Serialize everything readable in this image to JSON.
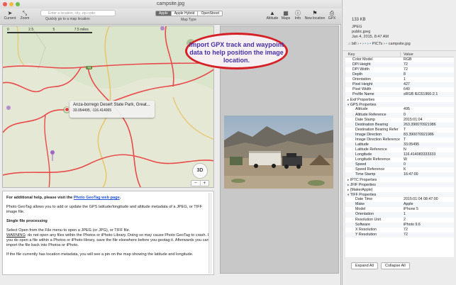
{
  "window": {
    "title": "campsite.jpg"
  },
  "toolbar": {
    "current_label": "Current",
    "zoom_label": "Zoom",
    "search_placeholder": "Enter a location, city, zip code",
    "quick_label": "Quickly go to a map location",
    "map_types": [
      "Apple",
      "Apple Hybrid",
      "OpenStreet"
    ],
    "map_type_selected": "Apple",
    "map_type_label": "Map Type",
    "right_buttons": [
      "Altitude",
      "Maps",
      "Info",
      "New location",
      "GPX"
    ]
  },
  "map": {
    "scale_labels": [
      "0",
      "2.5",
      "5",
      "7.5 miles"
    ],
    "route_number": "78",
    "pin_title": "Anza-borrego Desert State Park, Great...",
    "pin_coords": "33.054495, -116.414065",
    "btn_3d": "3D",
    "zoom_out": "−",
    "zoom_in": "+"
  },
  "callout": {
    "text": "Import GPX track and waypoint data to help position the image location."
  },
  "help": {
    "intro_prefix": "For additional help, please visit the ",
    "intro_link": "Photo GeoTag web page",
    "intro_suffix": ".",
    "p1": "Photo GeoTag allows you to add or update the GPS latitude/longitude and altitude metadata of a JPEG, or TIFF image file.",
    "heading": "Single file processing",
    "p2a": "Select Open from the File menu to open a JPEG (or JPG), or TIFF file.",
    "p2b_warning": "WARNING",
    "p2b": ": do not open any files within the Photos or iPhoto Library.  Doing so may cause Photo GeoTag to crash.  If you do open a file within a Photos or iPhoto library, save the file elsewhere before you geotag it.  Afterwards you can import the file back into Photos or iPhoto.",
    "p3": "If the file currently has location metadata, you will see a pin on the map showing the latitude and longitude."
  },
  "inspector": {
    "file_size": "133 KB",
    "format": "JPEG",
    "public": "public.jpeg",
    "date": "Jan 4, 2015, 8:47 AM",
    "path": [
      "bill",
      "",
      "",
      "PICTs",
      "",
      "campsite.jpg"
    ],
    "col_key": "Key",
    "col_value": "Value",
    "rows": [
      {
        "k": "Color Model",
        "v": "RGB",
        "i": 1
      },
      {
        "k": "DPI Height",
        "v": "72",
        "i": 1
      },
      {
        "k": "DPI Width",
        "v": "72",
        "i": 1
      },
      {
        "k": "Depth",
        "v": "8",
        "i": 1
      },
      {
        "k": "Orientation",
        "v": "1",
        "i": 1
      },
      {
        "k": "Pixel Height",
        "v": "427",
        "i": 1
      },
      {
        "k": "Pixel Width",
        "v": "640",
        "i": 1
      },
      {
        "k": "Profile Name",
        "v": "sRGB IEC61966-2.1",
        "i": 1
      },
      {
        "k": "Exif Properties",
        "v": "",
        "i": 0,
        "t": "▸"
      },
      {
        "k": "GPS Properties",
        "v": "",
        "i": 0,
        "t": "▾"
      },
      {
        "k": "Altitude",
        "v": "495",
        "i": 2
      },
      {
        "k": "Altitude Reference",
        "v": "0",
        "i": 2
      },
      {
        "k": "Date Stamp",
        "v": "2015:01:04",
        "i": 2
      },
      {
        "k": "Destination Bearing",
        "v": "263.390070921986",
        "i": 2
      },
      {
        "k": "Destination Bearing Refer",
        "v": "T",
        "i": 2
      },
      {
        "k": "Image Direction",
        "v": "83.390070921986",
        "i": 2
      },
      {
        "k": "Image Direction Reference",
        "v": "T",
        "i": 2
      },
      {
        "k": "Latitude",
        "v": "33.05495",
        "i": 2
      },
      {
        "k": "Latitude Reference",
        "v": "N",
        "i": 2
      },
      {
        "k": "Longitude",
        "v": "116.414083333333",
        "i": 2
      },
      {
        "k": "Longitude Reference",
        "v": "W",
        "i": 2
      },
      {
        "k": "Speed",
        "v": "0",
        "i": 2
      },
      {
        "k": "Speed Reference",
        "v": "K",
        "i": 2
      },
      {
        "k": "Time Stamp",
        "v": "16:47:00",
        "i": 2
      },
      {
        "k": "IPTC Properties",
        "v": "",
        "i": 0,
        "t": "▸"
      },
      {
        "k": "JFIF Properties",
        "v": "",
        "i": 0,
        "t": "▸"
      },
      {
        "k": "{MakerApple}",
        "v": "",
        "i": 0,
        "t": "▸"
      },
      {
        "k": "TIFF Properties",
        "v": "",
        "i": 0,
        "t": "▾"
      },
      {
        "k": "Date Time",
        "v": "2015:01:04 08:47:00",
        "i": 2
      },
      {
        "k": "Make",
        "v": "Apple",
        "i": 2
      },
      {
        "k": "Model",
        "v": "iPhone 5",
        "i": 2
      },
      {
        "k": "Orientation",
        "v": "1",
        "i": 2
      },
      {
        "k": "Resolution Unit",
        "v": "2",
        "i": 2
      },
      {
        "k": "Software",
        "v": "iPhoto 9.6",
        "i": 2
      },
      {
        "k": "X Resolution",
        "v": "72",
        "i": 2
      },
      {
        "k": "Y Resolution",
        "v": "72",
        "i": 2
      }
    ],
    "expand_all": "Expand All",
    "collapse_all": "Collapse All"
  }
}
